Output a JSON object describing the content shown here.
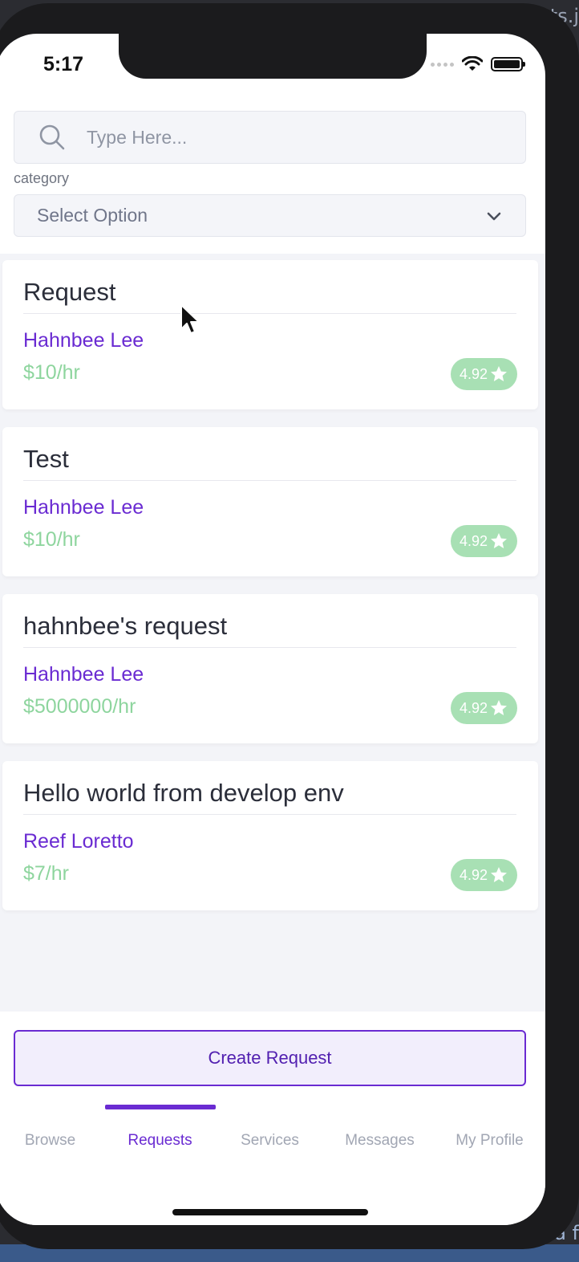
{
  "background": {
    "top_text": "sts.j",
    "bottom_text": ", a f"
  },
  "status_bar": {
    "time": "5:17"
  },
  "search": {
    "placeholder": "Type Here..."
  },
  "filter": {
    "label": "category",
    "selected": "Select Option"
  },
  "requests": [
    {
      "title": "Request",
      "author": "Hahnbee Lee",
      "rate": "$10/hr",
      "rating": "4.92"
    },
    {
      "title": "Test",
      "author": "Hahnbee Lee",
      "rate": "$10/hr",
      "rating": "4.92"
    },
    {
      "title": "hahnbee's request",
      "author": "Hahnbee Lee",
      "rate": "$5000000/hr",
      "rating": "4.92"
    },
    {
      "title": "Hello world from develop env",
      "author": "Reef Loretto",
      "rate": "$7/hr",
      "rating": "4.92"
    }
  ],
  "actions": {
    "create_label": "Create Request"
  },
  "tabs": [
    {
      "label": "Browse",
      "active": false
    },
    {
      "label": "Requests",
      "active": true
    },
    {
      "label": "Services",
      "active": false
    },
    {
      "label": "Messages",
      "active": false
    },
    {
      "label": "My Profile",
      "active": false
    }
  ],
  "colors": {
    "accent": "#6a2bd2",
    "rate": "#8ed59e",
    "rating_badge": "#a8e0b4"
  },
  "icons": [
    "search-icon",
    "chevron-down-icon",
    "star-icon",
    "wifi-icon",
    "battery-icon",
    "cursor-icon"
  ]
}
